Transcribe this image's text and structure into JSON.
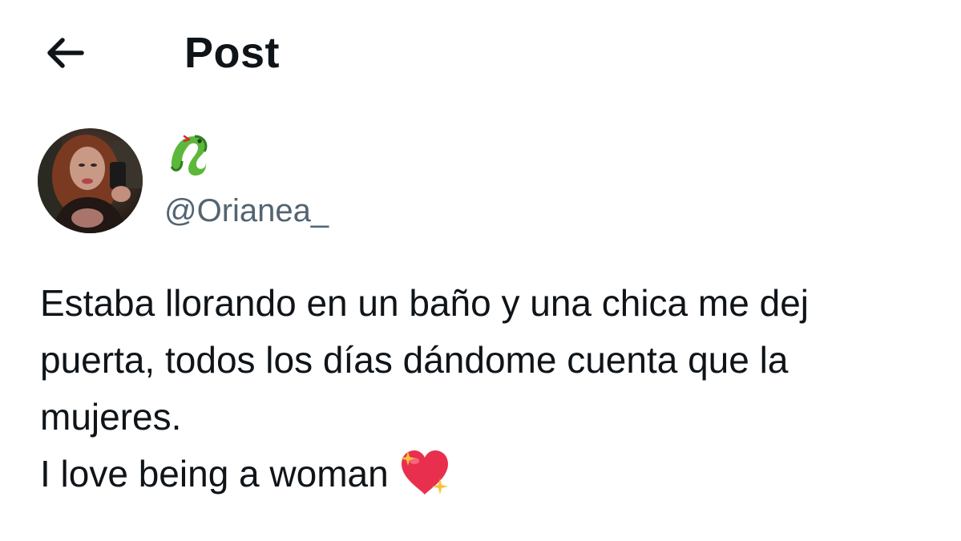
{
  "header": {
    "title": "Post"
  },
  "icons": {
    "back": "arrow-left-icon",
    "display_name": "snake-emoji-icon",
    "post_emoji": "sparkling-heart-icon"
  },
  "user": {
    "handle": "@Orianea_"
  },
  "post": {
    "lines": [
      "Estaba llorando en un baño y una chica me dej",
      "puerta, todos los días dándome cuenta que la",
      "mujeres.",
      "I love being a woman"
    ]
  },
  "colors": {
    "text_primary": "#0f1419",
    "text_secondary": "#536471",
    "snake": "#5cb83a",
    "heart": "#e8304e",
    "sparkle": "#f9c23c"
  }
}
